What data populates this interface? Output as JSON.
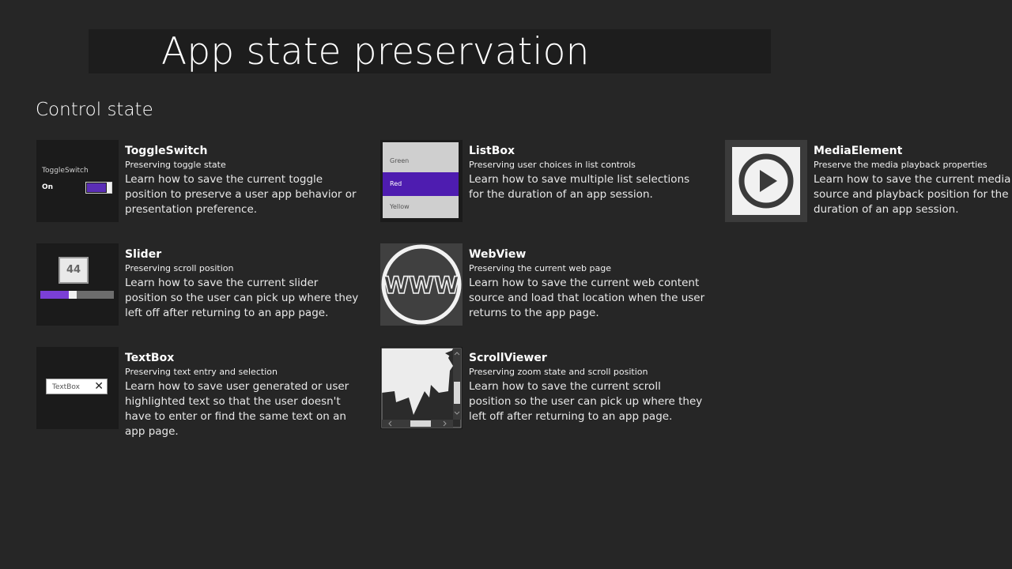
{
  "page": {
    "title": "App state preservation",
    "section_heading": "Control state"
  },
  "colors": {
    "background": "#262626",
    "accent_purple": "#5b2eb6",
    "listbox_selected": "#4e1cb0"
  },
  "tiles": [
    {
      "title": "ToggleSwitch",
      "subtitle": "Preserving toggle state",
      "description": "Learn how to save the current toggle position to preserve a user app behavior or presentation preference.",
      "thumb": {
        "label": "ToggleSwitch",
        "state": "On",
        "icon": "toggle-switch-icon"
      }
    },
    {
      "title": "ListBox",
      "subtitle": "Preserving user choices in list controls",
      "description": "Learn how to save multiple list selections for the duration of an app session.",
      "thumb": {
        "items": [
          "Green",
          "Red",
          "Yellow"
        ],
        "selected": "Red",
        "icon": "listbox-icon"
      }
    },
    {
      "title": "MediaElement",
      "subtitle": "Preserve the media playback properties",
      "description": "Learn how to save the current media source and playback position for the duration of an app session.",
      "thumb": {
        "icon": "play-icon"
      }
    },
    {
      "title": "Slider",
      "subtitle": "Preserving scroll position",
      "description": "Learn how to save the current slider position so the user can pick up where they left off after returning to an app page.",
      "thumb": {
        "value": "44",
        "icon": "slider-icon"
      }
    },
    {
      "title": "WebView",
      "subtitle": "Preserving the current web page",
      "description": "Learn how to save the current web content source and load that location when the user returns to the app page.",
      "thumb": {
        "label": "WWW",
        "icon": "globe-www-icon"
      }
    },
    {
      "title": "TextBox",
      "subtitle": "Preserving text entry and selection",
      "description": "Learn how to save user generated or user highlighted text so that the user doesn't have to enter or find the same text on an app page.",
      "thumb": {
        "value": "TextBox",
        "clear_glyph": "✕",
        "icon": "textbox-icon"
      }
    },
    {
      "title": "ScrollViewer",
      "subtitle": "Preserving zoom state and scroll position",
      "description": "Learn how to save the current scroll position so the user can pick up where they left off after returning to an app page.",
      "thumb": {
        "icon": "scrollviewer-icon"
      }
    }
  ]
}
